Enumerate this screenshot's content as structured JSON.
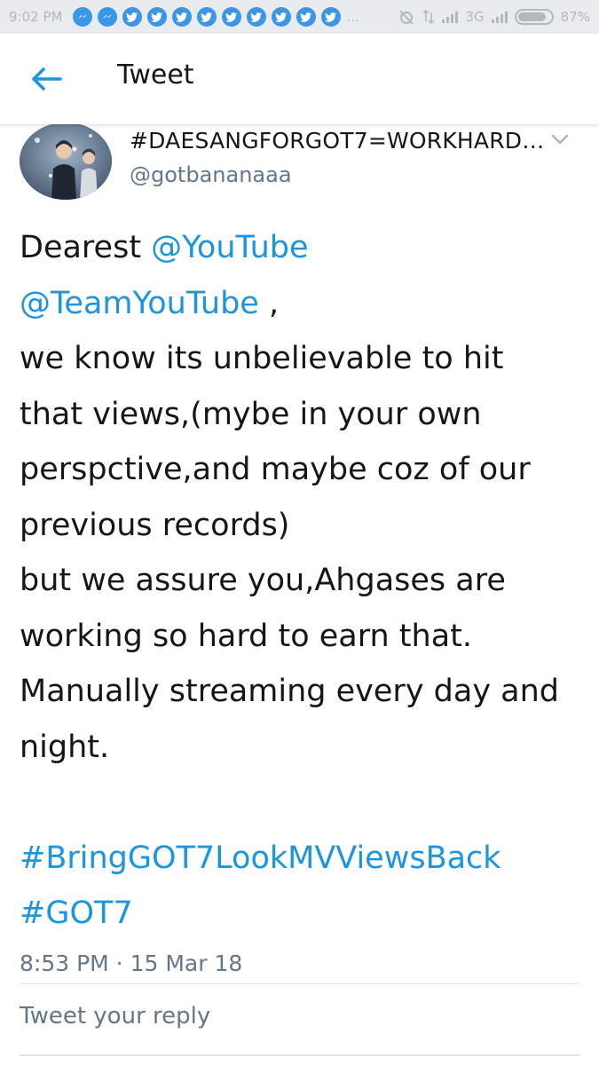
{
  "status_bar": {
    "time": "9:02 PM",
    "network": "3G",
    "battery_percent": "87%",
    "battery_level": 0.87,
    "ellipsis": "...",
    "notification_icons": [
      "messenger-icon",
      "messenger-icon",
      "twitter-icon",
      "twitter-icon",
      "twitter-icon",
      "twitter-icon",
      "twitter-icon",
      "twitter-icon",
      "twitter-icon",
      "twitter-icon",
      "twitter-icon"
    ]
  },
  "app_bar": {
    "title": "Tweet",
    "back_icon": "arrow-left-icon"
  },
  "tweet": {
    "display_name": "#DAESANGFORGOT7=WORKHARD…",
    "handle": "@gotbananaaa",
    "lines": {
      "l1_text": "Dearest ",
      "l1_mention": "@YouTube",
      "l2_mention": "@TeamYouTube",
      "l2_text": " ,",
      "l3": "we know its unbelievable to hit",
      "l4": "that views,(mybe in your own",
      "l5": "perspctive,and maybe coz of our",
      "l6": "previous records)",
      "l7": "but we assure you,Ahgases are",
      "l8": "working so hard to earn that.",
      "l9": "Manually streaming every day and",
      "l10": "night.",
      "hashtag1": "#BringGOT7LookMVViewsBack",
      "hashtag2": "#GOT7"
    },
    "timestamp": "8:53 PM · 15 Mar 18"
  },
  "reply": {
    "placeholder": "Tweet your reply"
  },
  "colors": {
    "link": "#1b95e0",
    "text": "#14171a",
    "secondary": "#657786",
    "status_bar_bg": "#e9ecef"
  }
}
